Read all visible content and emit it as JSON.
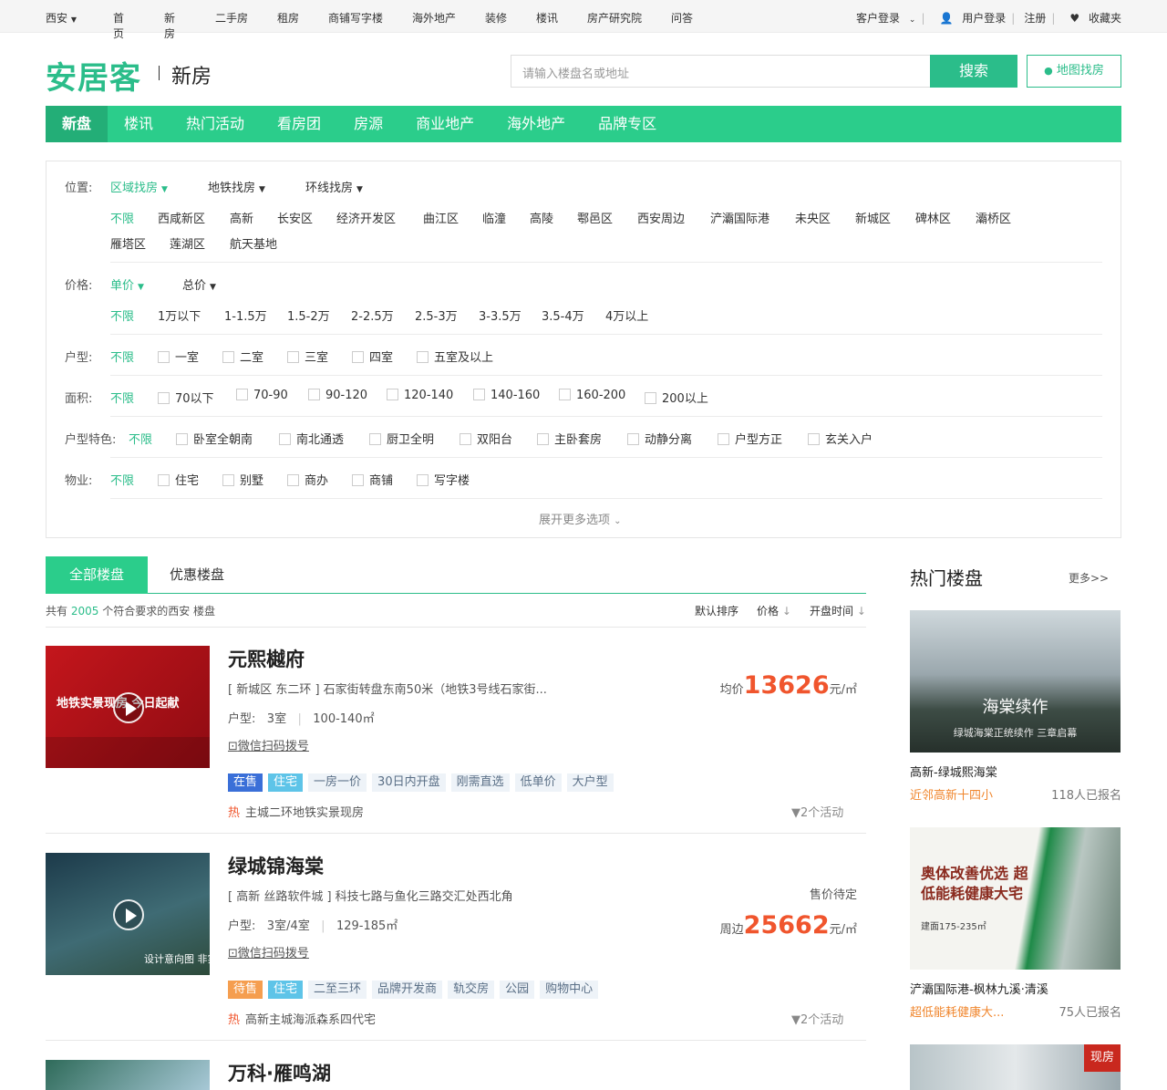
{
  "topbar": {
    "city": "西安",
    "nav": [
      "首页",
      "新房",
      "二手房",
      "租房",
      "商铺写字楼",
      "海外地产",
      "装修",
      "楼讯",
      "房产研究院",
      "问答"
    ],
    "client_login": "客户登录",
    "user_login": "用户登录",
    "register": "注册",
    "favorites": "收藏夹"
  },
  "header": {
    "logo": "安居客",
    "section": "新房",
    "search_placeholder": "请输入楼盘名或地址",
    "search_button": "搜索",
    "map_button": "地图找房"
  },
  "mainnav": [
    "新盘",
    "楼讯",
    "热门活动",
    "看房团",
    "房源",
    "商业地产",
    "海外地产",
    "品牌专区"
  ],
  "filter": {
    "location": {
      "label": "位置:",
      "modes": [
        "区域找房",
        "地铁找房",
        "环线找房"
      ],
      "row1": [
        "不限",
        "西咸新区",
        "高新",
        "长安区",
        "经济开发区",
        "曲江区",
        "临潼",
        "高陵",
        "鄠邑区",
        "西安周边",
        "浐灞国际港",
        "未央区",
        "新城区",
        "碑林区",
        "灞桥区"
      ],
      "row2": [
        "雁塔区",
        "莲湖区",
        "航天基地"
      ]
    },
    "price": {
      "label": "价格:",
      "modes": [
        "单价",
        "总价"
      ],
      "options": [
        "不限",
        "1万以下",
        "1-1.5万",
        "1.5-2万",
        "2-2.5万",
        "2.5-3万",
        "3-3.5万",
        "3.5-4万",
        "4万以上"
      ]
    },
    "layout": {
      "label": "户型:",
      "all": "不限",
      "options": [
        "一室",
        "二室",
        "三室",
        "四室",
        "五室及以上"
      ]
    },
    "area": {
      "label": "面积:",
      "all": "不限",
      "options": [
        "70以下",
        "70-90",
        "90-120",
        "120-140",
        "140-160",
        "160-200",
        "200以上"
      ]
    },
    "features": {
      "label": "户型特色:",
      "all": "不限",
      "options": [
        "卧室全朝南",
        "南北通透",
        "厨卫全明",
        "双阳台",
        "主卧套房",
        "动静分离",
        "户型方正",
        "玄关入户"
      ]
    },
    "property": {
      "label": "物业:",
      "all": "不限",
      "options": [
        "住宅",
        "别墅",
        "商办",
        "商铺",
        "写字楼"
      ]
    },
    "expand": "展开更多选项"
  },
  "tabs": {
    "all": "全部楼盘",
    "discount": "优惠楼盘"
  },
  "summary": {
    "prefix": "共有",
    "count": "2005",
    "suffix": "个符合要求的西安 楼盘"
  },
  "sort": {
    "default": "默认排序",
    "price": "价格",
    "open": "开盘时间"
  },
  "listings": [
    {
      "title": "元熙樾府",
      "address": "[ 新城区 东二环 ] 石家街转盘东南50米（地铁3号线石家街...",
      "type_label": "户型:",
      "rooms": "3室",
      "area": "100-140㎡",
      "wechat": "微信扫码拨号",
      "tags": [
        "在售",
        "住宅",
        "一房一价",
        "30日内开盘",
        "刚需直选",
        "低单价",
        "大户型"
      ],
      "hot_label": "热",
      "hot": "主城二环地铁实景现房",
      "activities": "2个活动",
      "price_prefix": "均价",
      "price": "13626",
      "price_unit": "元/㎡",
      "thumb_text": "地铁实景现房 今日起献"
    },
    {
      "title": "绿城锦海棠",
      "address": "[ 高新 丝路软件城 ] 科技七路与鱼化三路交汇处西北角",
      "type_label": "户型:",
      "rooms": "3室/4室",
      "area": "129-185㎡",
      "wechat": "微信扫码拨号",
      "tags": [
        "待售",
        "住宅",
        "二至三环",
        "品牌开发商",
        "轨交房",
        "公园",
        "购物中心"
      ],
      "hot_label": "热",
      "hot": "高新主城海派森系四代宅",
      "activities": "2个活动",
      "pending": "售价待定",
      "price_prefix": "周边",
      "price": "25662",
      "price_unit": "元/㎡",
      "thumb_text": "设计意向图 非实"
    },
    {
      "title": "万科·雁鸣湖"
    }
  ],
  "sidebar": {
    "title": "热门楼盘",
    "more": "更多>>",
    "items": [
      {
        "name": "高新-绿城熙海棠",
        "tag": "近邻高新十四小",
        "reg": "118人已报名",
        "img_text": "海棠续作",
        "img_sub": "绿城海棠正统续作 三章启幕"
      },
      {
        "name": "浐灞国际港-枫林九溪·清溪",
        "tag": "超低能耗健康大...",
        "reg": "75人已报名",
        "img_text": "奥体改善优选 超低能耗健康大宅",
        "img_sub": "建面175-235㎡"
      },
      {
        "img_text": "现房"
      }
    ]
  }
}
